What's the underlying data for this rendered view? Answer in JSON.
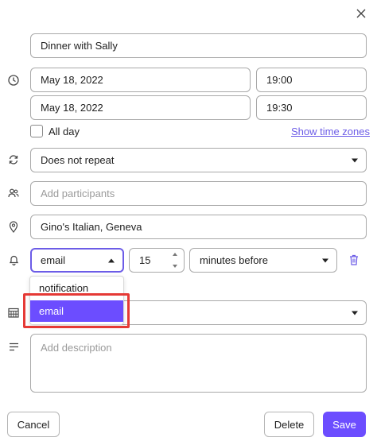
{
  "dialog": {
    "title_value": "Dinner with Sally",
    "start_date": "May 18, 2022",
    "start_time": "19:00",
    "end_date": "May 18, 2022",
    "end_time": "19:30",
    "all_day_label": "All day",
    "all_day_checked": false,
    "time_zones_link": "Show time zones",
    "repeat_value": "Does not repeat",
    "participants_placeholder": "Add participants",
    "location_value": "Gino's Italian, Geneva",
    "reminder": {
      "method_value": "email",
      "amount_value": "15",
      "unit_value": "minutes before",
      "method_options": [
        "notification",
        "email"
      ],
      "selected_option": "email"
    },
    "calendar_value": "",
    "description_placeholder": "Add description"
  },
  "footer": {
    "cancel_label": "Cancel",
    "delete_label": "Delete",
    "save_label": "Save"
  },
  "colors": {
    "accent": "#6c4dff",
    "link": "#6c5ce7",
    "highlight": "#e53935"
  },
  "icons": [
    "close-icon",
    "clock-icon",
    "repeat-icon",
    "participants-icon",
    "location-pin-icon",
    "bell-icon",
    "trash-icon",
    "calendar-icon",
    "description-icon"
  ]
}
